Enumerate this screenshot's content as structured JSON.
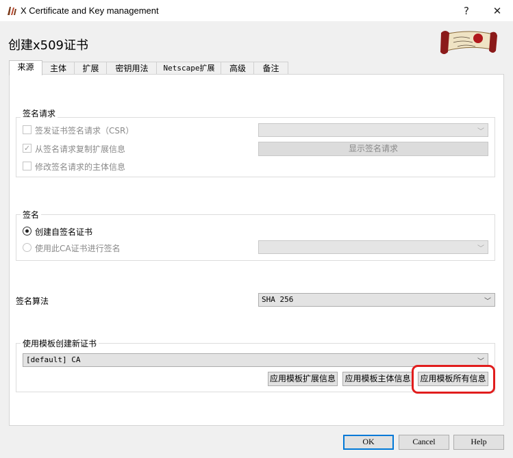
{
  "window": {
    "title": "X Certificate and Key management",
    "help_glyph": "?",
    "close_glyph": "✕"
  },
  "heading": "创建x509证书",
  "tabs": [
    "来源",
    "主体",
    "扩展",
    "密钥用法",
    "Netscape扩展",
    "高级",
    "备注"
  ],
  "signing_request": {
    "title": "签名请求",
    "sign_csr_label": "签发证书签名请求（CSR）",
    "copy_ext_label": "从签名请求复制扩展信息",
    "modify_subject_label": "修改签名请求的主体信息",
    "show_request_button": "显示签名请求"
  },
  "signing": {
    "title": "签名",
    "self_signed_label": "创建自签名证书",
    "use_ca_label": "使用此CA证书进行签名"
  },
  "algorithm": {
    "label": "签名算法",
    "value": "SHA 256"
  },
  "template": {
    "title": "使用模板创建新证书",
    "value": "[default] CA",
    "apply_ext_button": "应用模板扩展信息",
    "apply_subject_button": "应用模板主体信息",
    "apply_all_button": "应用模板所有信息"
  },
  "footer": {
    "ok": "OK",
    "cancel": "Cancel",
    "help": "Help"
  },
  "accent_color": "#0078d7",
  "highlight_color": "#e11d1d"
}
